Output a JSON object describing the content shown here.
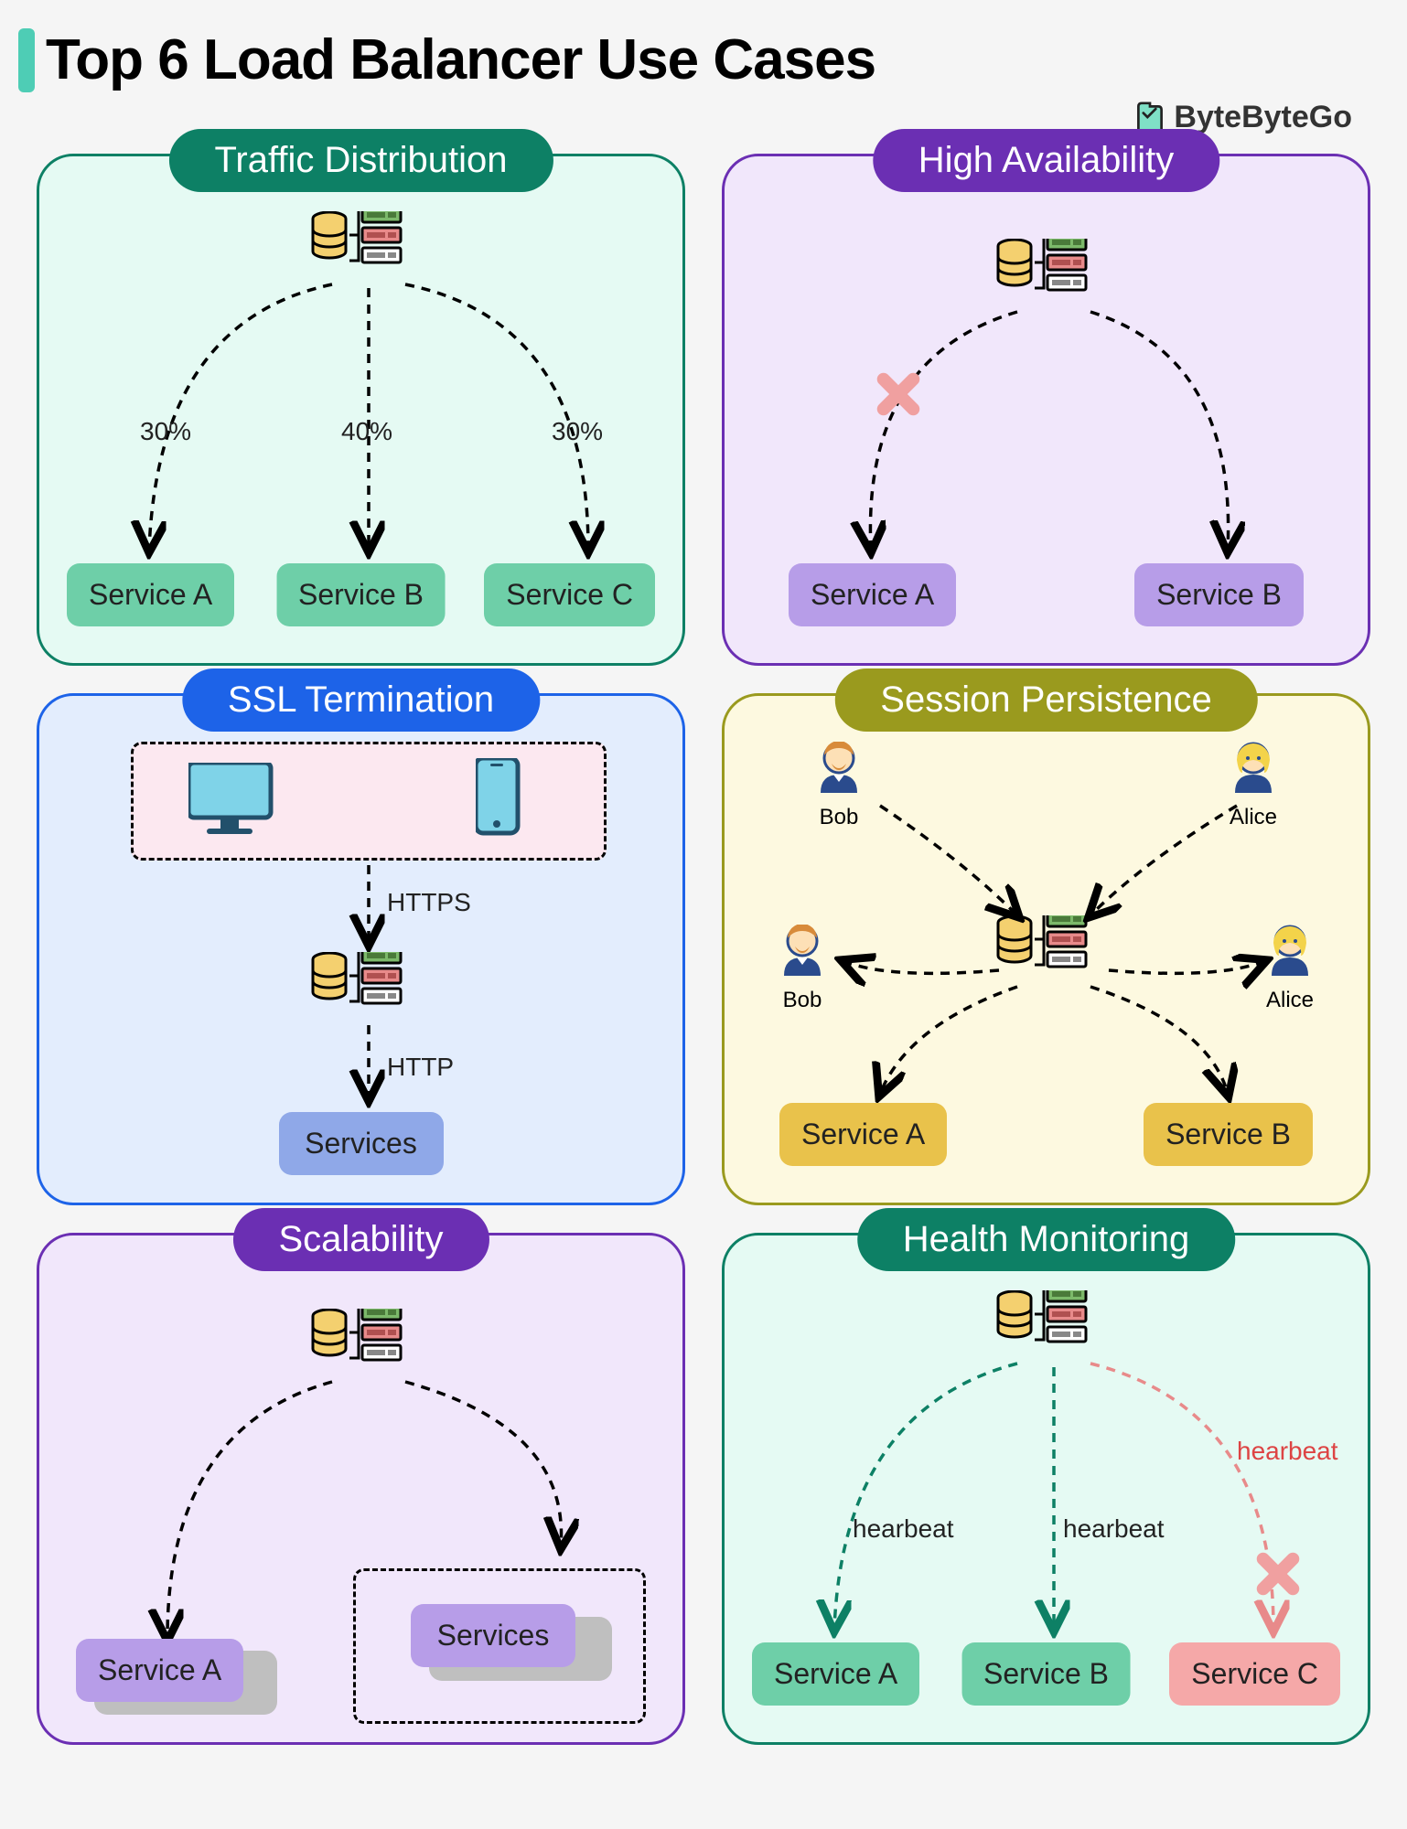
{
  "title": "Top 6 Load Balancer Use Cases",
  "brand": "ByteByteGo",
  "cards": {
    "traffic": {
      "title": "Traffic Distribution",
      "pct_a": "30%",
      "pct_b": "40%",
      "pct_c": "30%",
      "svc_a": "Service A",
      "svc_b": "Service B",
      "svc_c": "Service C"
    },
    "ha": {
      "title": "High Availability",
      "svc_a": "Service A",
      "svc_b": "Service B"
    },
    "ssl": {
      "title": "SSL Termination",
      "https": "HTTPS",
      "http": "HTTP",
      "svc": "Services"
    },
    "session": {
      "title": "Session Persistence",
      "bob": "Bob",
      "alice": "Alice",
      "svc_a": "Service A",
      "svc_b": "Service B"
    },
    "scale": {
      "title": "Scalability",
      "svc_a": "Service A",
      "svc_b": "Services"
    },
    "health": {
      "title": "Health Monitoring",
      "hb": "hearbeat",
      "svc_a": "Service A",
      "svc_b": "Service B",
      "svc_c": "Service C"
    }
  }
}
